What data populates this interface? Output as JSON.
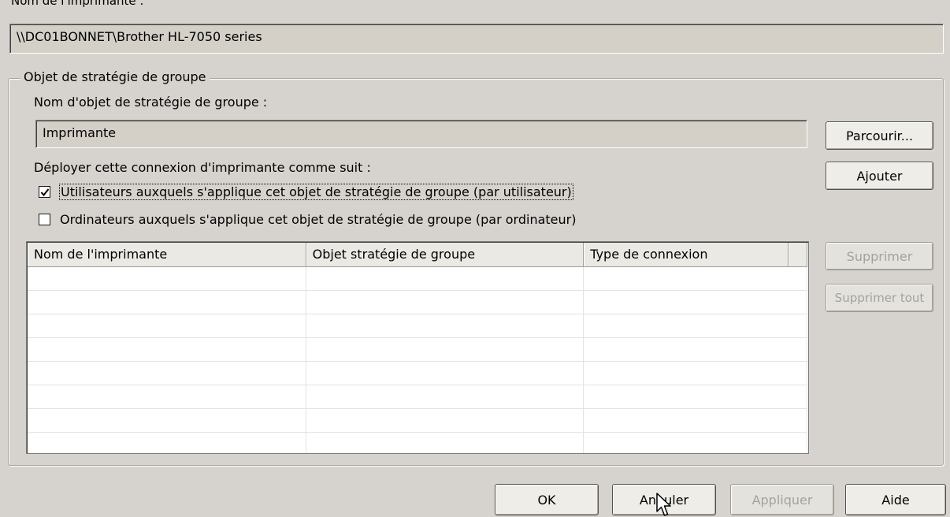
{
  "printer_name_label": "Nom de l'imprimante :",
  "printer_path": "\\\\DC01BONNET\\Brother HL-7050 series",
  "gpo_group": {
    "legend": "Objet de stratégie de groupe",
    "gpo_name_label": "Nom d'objet de stratégie de groupe :",
    "gpo_name_value": "Imprimante",
    "deploy_label": "Déployer cette connexion d'imprimante comme suit :",
    "users_checkbox": {
      "label": "Utilisateurs auxquels s'applique cet objet de stratégie de groupe (par utilisateur)",
      "checked": true
    },
    "computers_checkbox": {
      "label": "Ordinateurs auxquels s'applique cet objet de stratégie de groupe (par ordinateur)",
      "checked": false
    }
  },
  "side_buttons": {
    "browse": "Parcourir...",
    "add": "Ajouter",
    "remove": "Supprimer",
    "remove_all": "Supprimer tout"
  },
  "list": {
    "columns": [
      "Nom de l'imprimante",
      "Objet stratégie de groupe",
      "Type de connexion"
    ],
    "rows": []
  },
  "footer_buttons": {
    "ok": "OK",
    "cancel": "Annuler",
    "apply": "Appliquer",
    "help": "Aide"
  }
}
